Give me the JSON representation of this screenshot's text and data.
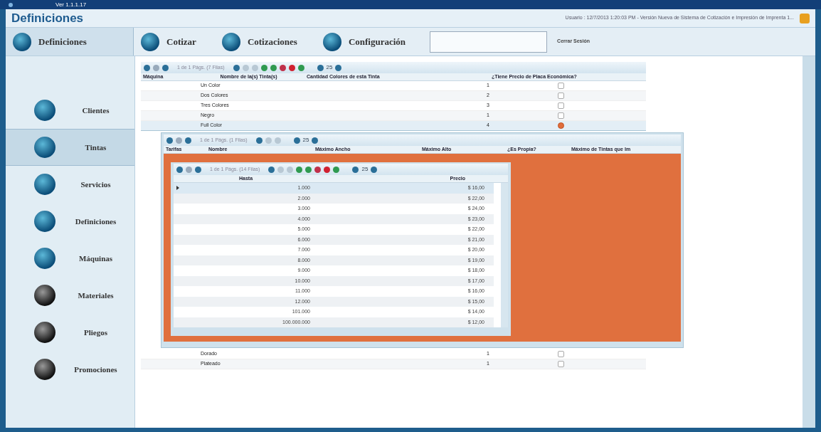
{
  "window": {
    "title": "Ver 1.1.1.17"
  },
  "header": {
    "title": "Definiciones",
    "status": "Usuario : 12/7/2013 1:20:03 PM - Versión Nueva de Sistema de Cotización e Impresión de Imprenta 1..."
  },
  "tabs": [
    {
      "label": "Definiciones",
      "selected": true
    },
    {
      "label": "Cotizar",
      "selected": false
    },
    {
      "label": "Cotizaciones",
      "selected": false
    },
    {
      "label": "Configuración",
      "selected": false
    }
  ],
  "logout_button": "Cerrar Sesión",
  "sidebar": {
    "items": [
      {
        "label": "Clientes",
        "selected": false
      },
      {
        "label": "Tintas",
        "selected": true
      },
      {
        "label": "Servicios",
        "selected": false
      },
      {
        "label": "Definiciones",
        "selected": false
      },
      {
        "label": "Máquinas",
        "selected": false
      },
      {
        "label": "Materiales",
        "selected": false
      },
      {
        "label": "Pliegos",
        "selected": false
      },
      {
        "label": "Promociones",
        "selected": false
      }
    ]
  },
  "grid": {
    "pager": "1 de 1 Págs. (7 Filas)",
    "page_size": "25",
    "columns": [
      "Máquina",
      "Nombre de la(s) Tinta(s)",
      "Cantidad Colores de esta Tinta",
      "¿Tiene Precio de Placa Económica?"
    ],
    "rows": [
      {
        "name": "Un Color",
        "colors": "1",
        "economic_plate": false,
        "expanded": false
      },
      {
        "name": "Dos Colores",
        "colors": "2",
        "economic_plate": false,
        "expanded": false
      },
      {
        "name": "Tres Colores",
        "colors": "3",
        "economic_plate": false,
        "expanded": false
      },
      {
        "name": "Negro",
        "colors": "1",
        "economic_plate": false,
        "expanded": false
      },
      {
        "name": "Full Color",
        "colors": "4",
        "economic_plate": true,
        "expanded": true
      },
      {
        "name": "Dorado",
        "colors": "1",
        "economic_plate": false,
        "expanded": false
      },
      {
        "name": "Plateado",
        "colors": "1",
        "economic_plate": false,
        "expanded": false
      }
    ],
    "detail": {
      "pager": "1 de 1 Págs. (1 Filas)",
      "page_size": "25",
      "columns": [
        "Tarifas",
        "Nombre",
        "Máximo Ancho",
        "Máximo Alto",
        "¿Es Propia?",
        "Máximo de Tintas que Im"
      ],
      "rows": [
        {
          "selected": true
        }
      ],
      "detail": {
        "pager": "1 de 1 Págs. (14 Filas)",
        "page_size": "25",
        "columns": [
          "Hasta",
          "Precio"
        ],
        "rows": [
          {
            "hasta": "1.000",
            "precio": "$ 16,00",
            "selected": true
          },
          {
            "hasta": "2.000",
            "precio": "$ 22,00",
            "selected": false
          },
          {
            "hasta": "3.000",
            "precio": "$ 24,00",
            "selected": false
          },
          {
            "hasta": "4.000",
            "precio": "$ 23,00",
            "selected": false
          },
          {
            "hasta": "5.000",
            "precio": "$ 22,00",
            "selected": false
          },
          {
            "hasta": "6.000",
            "precio": "$ 21,00",
            "selected": false
          },
          {
            "hasta": "7.000",
            "precio": "$ 20,00",
            "selected": false
          },
          {
            "hasta": "8.000",
            "precio": "$ 19,00",
            "selected": false
          },
          {
            "hasta": "9.000",
            "precio": "$ 18,00",
            "selected": false
          },
          {
            "hasta": "10.000",
            "precio": "$ 17,00",
            "selected": false
          },
          {
            "hasta": "11.000",
            "precio": "$ 16,00",
            "selected": false
          },
          {
            "hasta": "12.000",
            "precio": "$ 15,00",
            "selected": false
          },
          {
            "hasta": "101.000",
            "precio": "$ 14,00",
            "selected": false
          },
          {
            "hasta": "100.000.000",
            "precio": "$ 12,00",
            "selected": false
          }
        ]
      }
    }
  }
}
